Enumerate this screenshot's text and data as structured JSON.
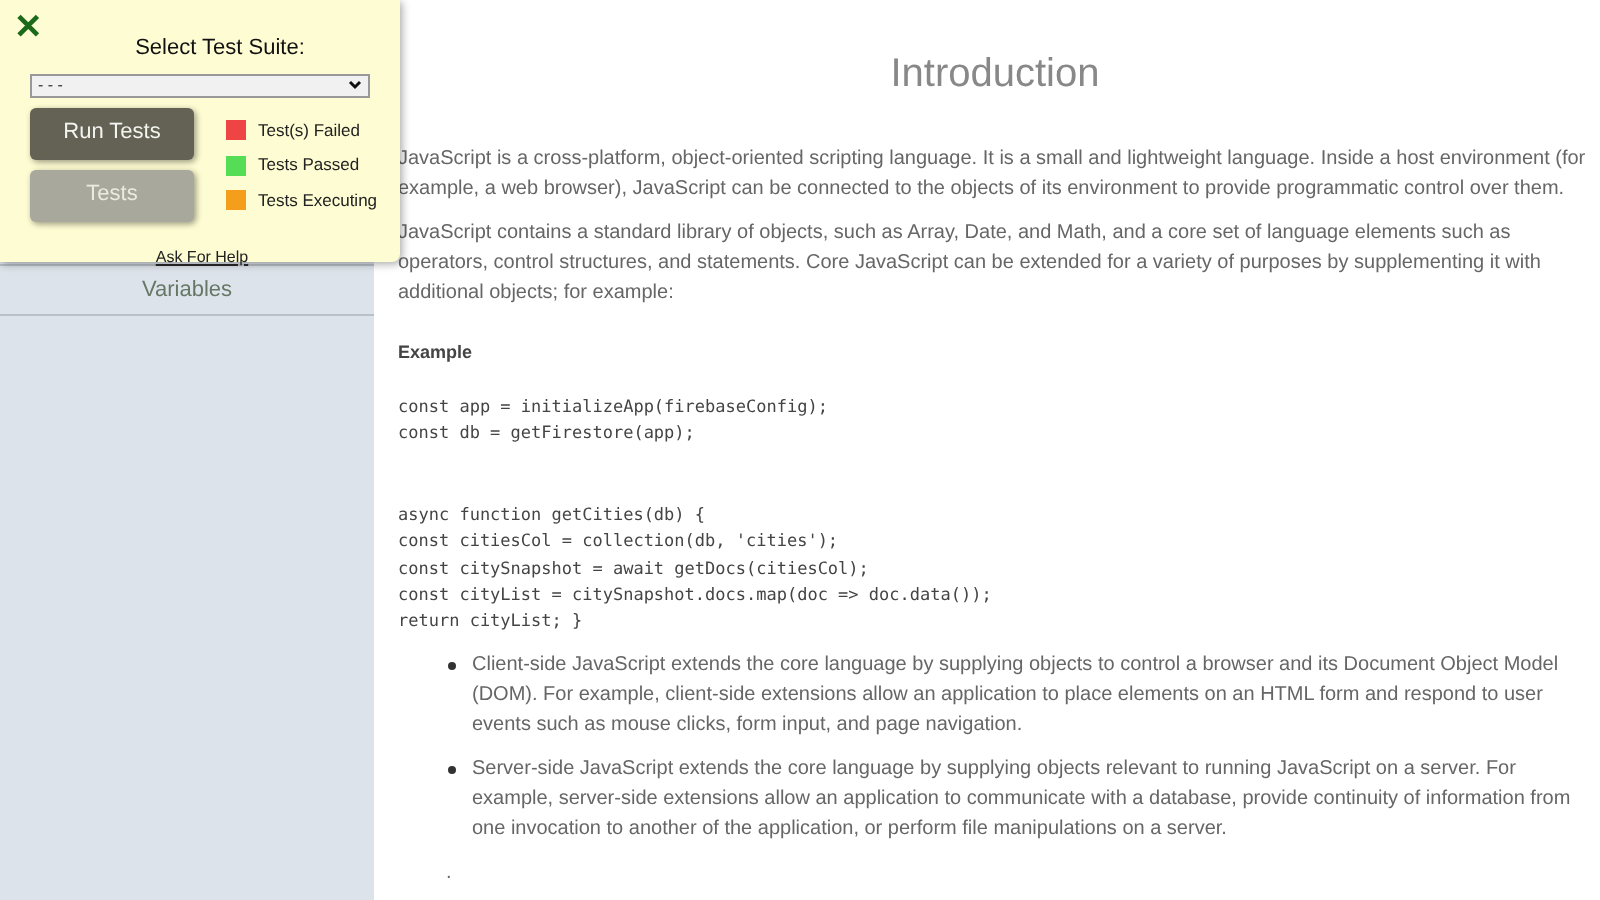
{
  "sidebar": {
    "items": [
      {
        "label": "Variables",
        "selected": false
      }
    ]
  },
  "test_panel": {
    "close_icon": "✕",
    "title": "Select Test Suite:",
    "select_value": "- - -",
    "buttons": [
      {
        "label": "Run Tests",
        "disabled": false
      },
      {
        "label": "Tests",
        "disabled": true
      }
    ],
    "legend": [
      {
        "label": "Test(s) Failed",
        "color": "#ee4444"
      },
      {
        "label": "Tests Passed",
        "color": "#55dd55"
      },
      {
        "label": "Tests Executing",
        "color": "#f59e1b"
      }
    ],
    "help_link": "Ask For Help"
  },
  "content": {
    "title": "Introduction",
    "paragraphs": [
      "JavaScript is a cross-platform, object-oriented scripting language. It is a small and lightweight language. Inside a host environment (for example, a web browser), JavaScript can be connected to the objects of its environment to provide programmatic control over them.",
      "JavaScript contains a standard library of objects, such as Array, Date, and Math, and a core set of language elements such as operators, control structures, and statements. Core JavaScript can be extended for a variety of purposes by supplementing it with additional objects; for example:"
    ],
    "example_heading": "Example",
    "code_blocks": [
      [
        "const app = initializeApp(firebaseConfig);",
        "const db = getFirestore(app);"
      ],
      [
        "async function getCities(db) {",
        "const citiesCol = collection(db, 'cities');",
        "const citySnapshot = await getDocs(citiesCol);",
        "const cityList = citySnapshot.docs.map(doc => doc.data());",
        "return cityList; }"
      ]
    ],
    "bullets": [
      "Client-side JavaScript extends the core language by supplying objects to control a browser and its Document Object Model (DOM). For example, client-side extensions allow an application to place elements on an HTML form and respond to user events such as mouse clicks, form input, and page navigation.",
      "Server-side JavaScript extends the core language by supplying objects relevant to running JavaScript on a server. For example, server-side extensions allow an application to communicate with a database, provide continuity of information from one invocation to another of the application, or perform file manipulations on a server."
    ],
    "trailing_text": "."
  }
}
